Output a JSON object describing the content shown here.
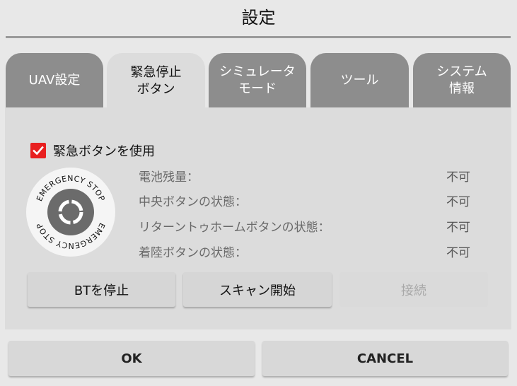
{
  "dialog": {
    "title": "設定"
  },
  "tabs": [
    {
      "label": "UAV設定",
      "active": false
    },
    {
      "label": "緊急停止\nボタン",
      "active": true
    },
    {
      "label": "シミュレータ\nモード",
      "active": false
    },
    {
      "label": "ツール",
      "active": false
    },
    {
      "label": "システム\n情報",
      "active": false
    }
  ],
  "emergency": {
    "use_label": "緊急ボタンを使用",
    "use_checked": true,
    "logo_text": "EMERGENCY STOP",
    "status": [
      {
        "label": "電池残量：",
        "value": "不可"
      },
      {
        "label": "中央ボタンの状態：",
        "value": "不可"
      },
      {
        "label": "リターントゥホームボタンの状態：",
        "value": "不可"
      },
      {
        "label": "着陸ボタンの状態：",
        "value": "不可"
      }
    ],
    "buttons": {
      "stop_bt": "BTを停止",
      "scan": "スキャン開始",
      "connect": "接続"
    }
  },
  "footer": {
    "ok": "OK",
    "cancel": "CANCEL"
  },
  "colors": {
    "tab_inactive": "#8d8d8d",
    "tab_active": "#dcdcdc",
    "checkbox": "#e81f1f",
    "rule": "#9a9a9a"
  },
  "icons": {
    "checkbox": "check-icon",
    "logo": "emergency-stop-icon"
  }
}
